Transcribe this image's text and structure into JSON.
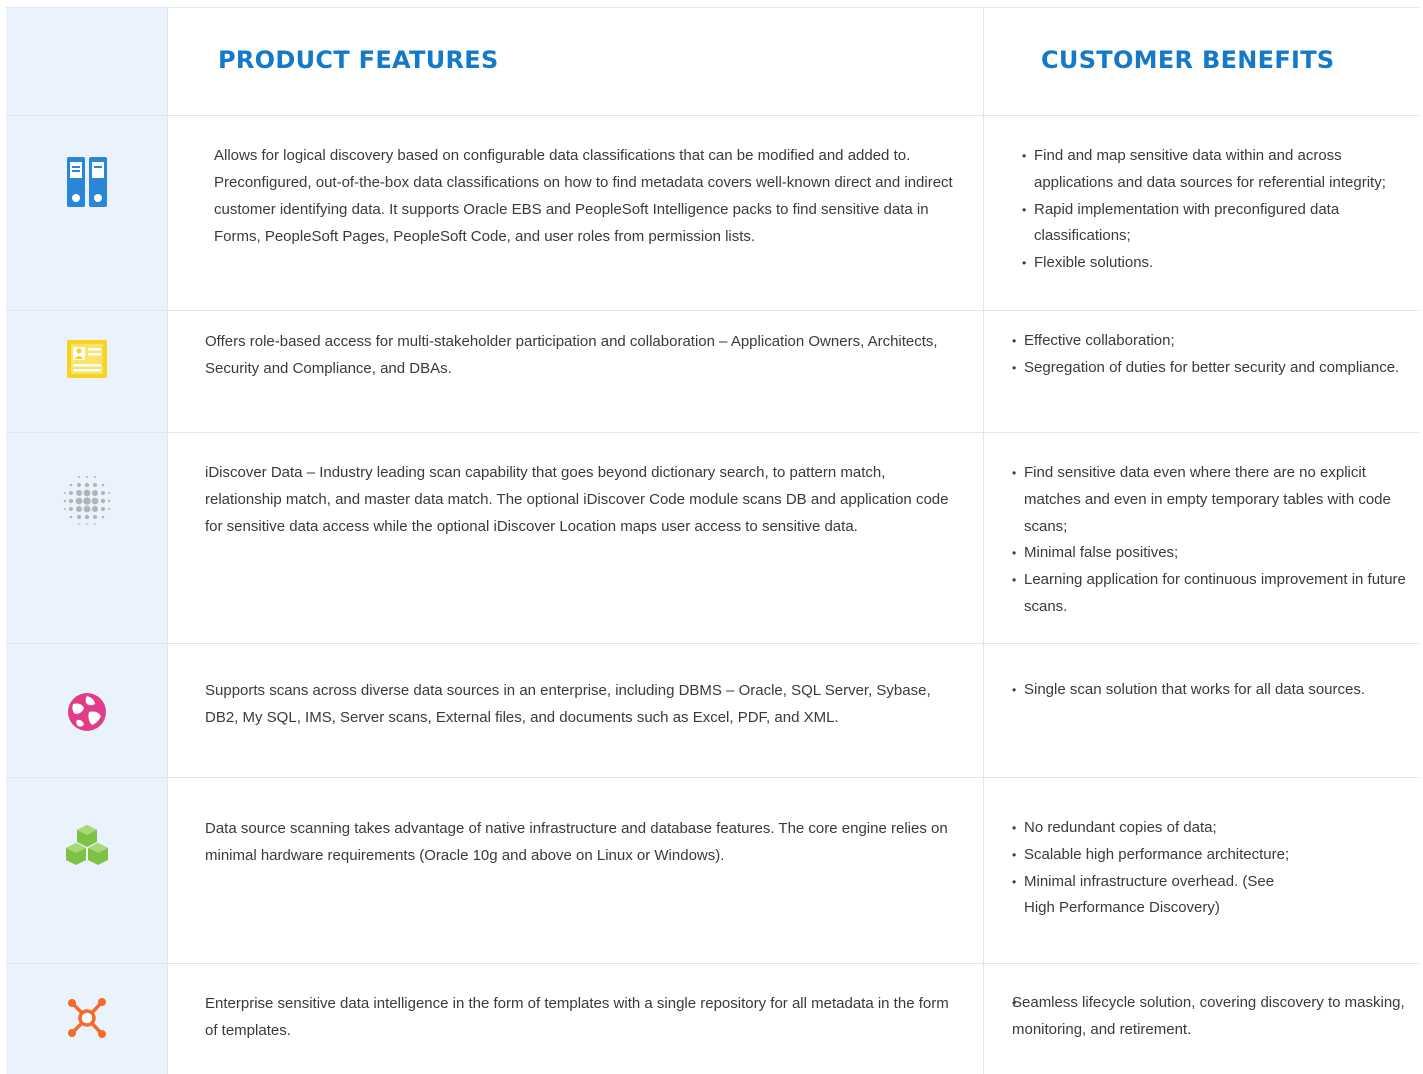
{
  "header": {
    "features_title": "PRODUCT FEATURES",
    "benefits_title": "CUSTOMER BENEFITS"
  },
  "rows": [
    {
      "icon": "binders-icon",
      "icon_color": "#2a86d6",
      "feature": "Allows for logical discovery based on configurable data classifications that can be modified and added to. Preconfigured, out-of-the-box data classifications on how to find metadata covers well-known direct and indirect customer identifying data. It supports Oracle EBS and PeopleSoft Intelligence packs to find sensitive data in Forms, PeopleSoft Pages, PeopleSoft Code, and user roles from permission lists.",
      "benefits": [
        "Find and map sensitive data within and  across applications and data sources for  referential integrity;",
        "Rapid implementation with preconfigured  data classifications;",
        "Flexible solutions."
      ]
    },
    {
      "icon": "id-card-icon",
      "icon_color": "#f7d21e",
      "feature": "Offers role-based access for multi-stakeholder participation and collaboration – Application Owners, Architects, Security and Compliance, and DBAs.",
      "benefits": [
        "Effective collaboration;",
        "Segregation of duties for better security  and compliance."
      ]
    },
    {
      "icon": "dot-sphere-icon",
      "icon_color": "#9aa0a6",
      "feature": "iDiscover Data – Industry leading scan capability that goes beyond dictionary search, to pattern match, relationship match, and master data match. The optional iDiscover Code module scans DB and application code for sensitive data access while the optional iDiscover Location maps user access to sensitive data.",
      "benefits": [
        "Find sensitive data even where there are  no explicit matches and even in empty  temporary tables with code scans;",
        "Minimal false positives;",
        "Learning application for continuous  improvement in future scans."
      ]
    },
    {
      "icon": "globe-icon",
      "icon_color": "#e03c8a",
      "feature": "Supports scans across diverse data sources in an enterprise, including DBMS – Oracle, SQL Server, Sybase, DB2, My SQL, IMS, Server scans, External files, and documents such as Excel, PDF, and XML.",
      "benefits": [
        "Single scan solution that works for all data  sources."
      ]
    },
    {
      "icon": "stacked-cubes-icon",
      "icon_color": "#7cc243",
      "feature": "Data source scanning takes advantage of native infrastructure and database features. The core engine relies on minimal hardware requirements (Oracle 10g and above on Linux or Windows).",
      "benefits": [
        "No redundant copies of data;",
        "Scalable high performance architecture;",
        "Minimal infrastructure overhead.  (See High Performance Discovery)"
      ]
    },
    {
      "icon": "hub-network-icon",
      "icon_color": "#f26b2b",
      "feature": "Enterprise sensitive data intelligence in the form of templates with a single repository for all metadata in the form of templates.",
      "benefits": [
        "Seamless lifecycle solution, covering  discovery to masking, monitoring, and  retirement."
      ]
    }
  ]
}
